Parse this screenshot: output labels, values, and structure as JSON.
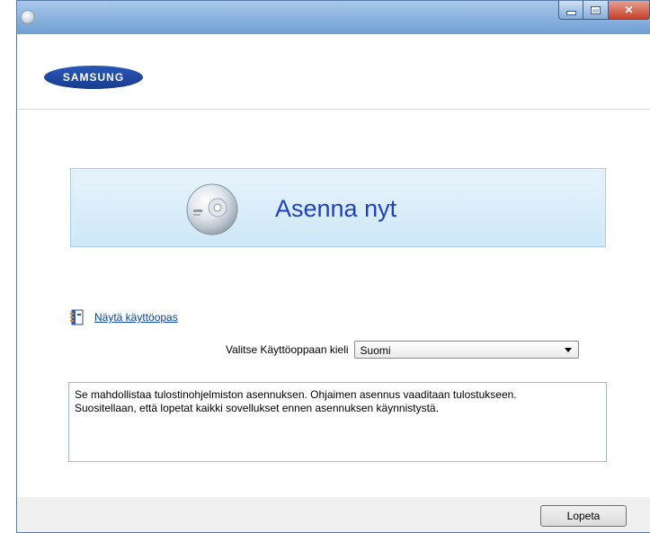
{
  "window": {
    "app_icon": "cd-app-icon",
    "caption_buttons": [
      "minimize-icon",
      "maximize-icon",
      "close-icon"
    ]
  },
  "header": {
    "logo_text": "SAMSUNG",
    "logo_color": "#1c48a8"
  },
  "main": {
    "install_button_label": "Asenna nyt",
    "install_icon": "cd-disc-icon",
    "guide_link_label": "Näytä käyttöopas",
    "guide_icon": "book-icon",
    "language_label": "Valitse Käyttöoppaan kieli",
    "language_selected": "Suomi",
    "description_lines": [
      "Se mahdollistaa tulostinohjelmiston asennuksen. Ohjaimen asennus vaaditaan tulostukseen.",
      "Suositellaan, että lopetat kaikki sovellukset ennen asennuksen käynnistystä."
    ]
  },
  "footer": {
    "quit_label": "Lopeta"
  },
  "colors": {
    "link": "#0645ad",
    "install_text": "#1f3fc4",
    "install_bg": "#d6ecf8"
  }
}
